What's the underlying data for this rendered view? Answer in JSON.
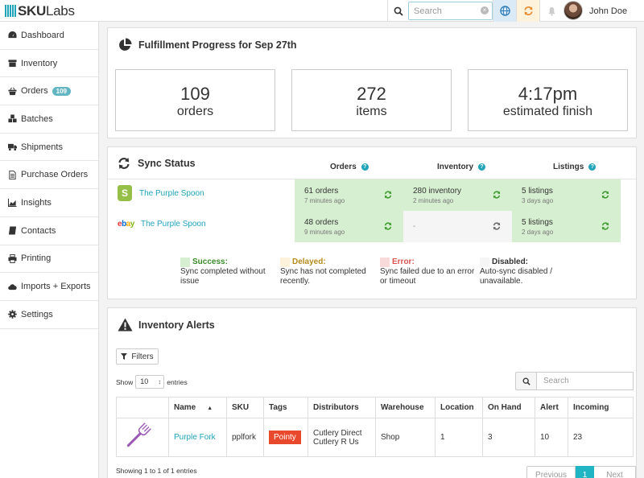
{
  "brand": {
    "name_bold": "SKU",
    "name_rest": "Labs"
  },
  "topbar": {
    "search_placeholder": "Search",
    "user_name": "John Doe"
  },
  "sidebar": {
    "items": [
      {
        "label": "Dashboard",
        "icon": "dashboard-icon"
      },
      {
        "label": "Inventory",
        "icon": "box-icon"
      },
      {
        "label": "Orders",
        "icon": "basket-icon",
        "badge": "109"
      },
      {
        "label": "Batches",
        "icon": "cubes-icon"
      },
      {
        "label": "Shipments",
        "icon": "truck-icon"
      },
      {
        "label": "Purchase Orders",
        "icon": "file-icon"
      },
      {
        "label": "Insights",
        "icon": "chart-icon"
      },
      {
        "label": "Contacts",
        "icon": "book-icon"
      },
      {
        "label": "Printing",
        "icon": "print-icon"
      },
      {
        "label": "Imports + Exports",
        "icon": "cloud-icon"
      },
      {
        "label": "Settings",
        "icon": "gear-icon"
      }
    ]
  },
  "fulfillment": {
    "title": "Fulfillment Progress for Sep 27th",
    "stats": [
      {
        "value": "109",
        "label": "orders"
      },
      {
        "value": "272",
        "label": "items"
      },
      {
        "value": "4:17pm",
        "label": "estimated finish"
      }
    ]
  },
  "sync": {
    "title": "Sync Status",
    "columns": [
      "Orders",
      "Inventory",
      "Listings"
    ],
    "rows": [
      {
        "store": "The Purple Spoon",
        "channel": "shopify",
        "cells": [
          {
            "value": "61 orders",
            "time": "7 minutes ago",
            "state": "ok"
          },
          {
            "value": "280 inventory",
            "time": "2 minutes ago",
            "state": "ok"
          },
          {
            "value": "5 listings",
            "time": "3 days ago",
            "state": "ok"
          }
        ]
      },
      {
        "store": "The Purple Spoon",
        "channel": "ebay",
        "cells": [
          {
            "value": "48 orders",
            "time": "9 minutes ago",
            "state": "ok"
          },
          {
            "value": "-",
            "time": "",
            "state": "off"
          },
          {
            "value": "5 listings",
            "time": "2 days ago",
            "state": "ok"
          }
        ]
      }
    ],
    "ebay_letters": [
      "e",
      "b",
      "a",
      "y"
    ],
    "legend": [
      {
        "title": "Success:",
        "desc": "Sync completed without issue",
        "color": "#d7efd1",
        "title_color": "#3a8a2a"
      },
      {
        "title": "Delayed:",
        "desc": "Sync has not completed recently.",
        "color": "#fdf3dc",
        "title_color": "#b58a1c"
      },
      {
        "title": "Error:",
        "desc": "Sync failed due to an error or timeout",
        "color": "#f9dada",
        "title_color": "#d9534f"
      },
      {
        "title": "Disabled:",
        "desc": "Auto-sync disabled / unavailable.",
        "color": "#f5f5f5",
        "title_color": "#333333"
      }
    ]
  },
  "alerts": {
    "title": "Inventory Alerts",
    "filters_label": "Filters",
    "show_label": "Show",
    "show_value": "10",
    "entries_label": "entries",
    "search_placeholder": "Search",
    "headers": [
      "",
      "Name",
      "SKU",
      "Tags",
      "Distributors",
      "Warehouse",
      "Location",
      "On Hand",
      "Alert",
      "Incoming"
    ],
    "row": {
      "name": "Purple Fork",
      "sku": "pplfork",
      "tag": "Pointy",
      "distributors": [
        "Cutlery Direct",
        "Cutlery R Us"
      ],
      "warehouse": "Shop",
      "location": "1",
      "on_hand": "3",
      "alert": "10",
      "incoming": "23"
    },
    "showing_text": "Showing 1 to 1 of 1 entries",
    "pager": {
      "prev": "Previous",
      "current": "1",
      "next": "Next"
    }
  }
}
